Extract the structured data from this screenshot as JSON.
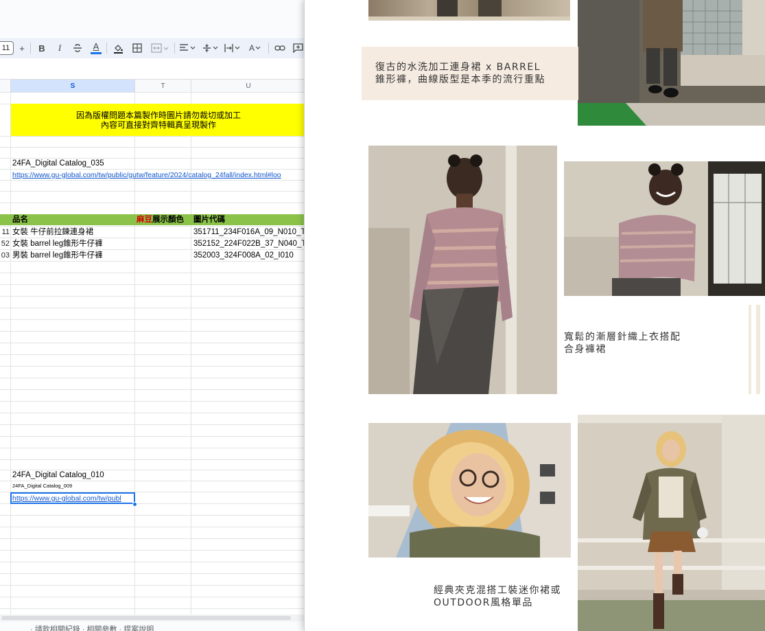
{
  "spreadsheet": {
    "toolbar": {
      "font_size": "11",
      "plus_label": "+",
      "bold_label": "B",
      "italic_label": "I",
      "text_color_label": "A",
      "text_format_label": "A"
    },
    "columns": [
      "S",
      "T",
      "U"
    ],
    "banner": {
      "line1": "因為版權問題本篇製作時圖片請勿裁切或加工",
      "line2": "內容可直接對齊特輯真呈現製作"
    },
    "catalog_035": {
      "title": "24FA_Digital Catalog_035",
      "url": "https://www.gu-global.com/tw/public/gutw/feature/2024/catalog_24fall/index.html#loo"
    },
    "table": {
      "headers": {
        "name": "品名",
        "color_highlight": "麻豆",
        "color_rest": "展示顏色",
        "code": "圖片代碼"
      },
      "rows": [
        {
          "rowno": "11",
          "name": "女裝 牛仔前拉鍊連身裙",
          "code": "351711_234F016A_09_N010_T"
        },
        {
          "rowno": "52",
          "name": "女裝 barrel leg錐形牛仔褲",
          "code": "352152_224F022B_37_N040_T"
        },
        {
          "rowno": "03",
          "name": "男裝 barrel leg錐形牛仔褲",
          "code": "352003_324F008A_02_I010"
        }
      ]
    },
    "catalog_010": {
      "title": "24FA_Digital Catalog_010",
      "subtitle": "24FA_Digital Catalog_009",
      "url": "https://www.gu-global.com/tw/publ"
    },
    "sheet_tabs": "· 請款相關紀錄   · 相關參數   · 提案說明"
  },
  "catalog_page": {
    "captions": {
      "caption1_line1": "復古的水洗加工連身裙 x BARREL",
      "caption1_line2": "錐形褲，曲線版型是本季的流行重點",
      "caption2_line1": "寬鬆的漸層針織上衣搭配",
      "caption2_line2": "合身褲裙",
      "caption3_line1": "經典夾克混搭工裝迷你裙或",
      "caption3_line2": "OUTDOOR風格單品"
    },
    "colors": {
      "caption_box": "#f6ebe1",
      "text": "#333333"
    }
  },
  "colors": {
    "banner": "#ffff00",
    "header_row": "#8bc34a",
    "highlight_text": "#d60000",
    "link": "#1155cc",
    "selection": "#1a73e8"
  }
}
